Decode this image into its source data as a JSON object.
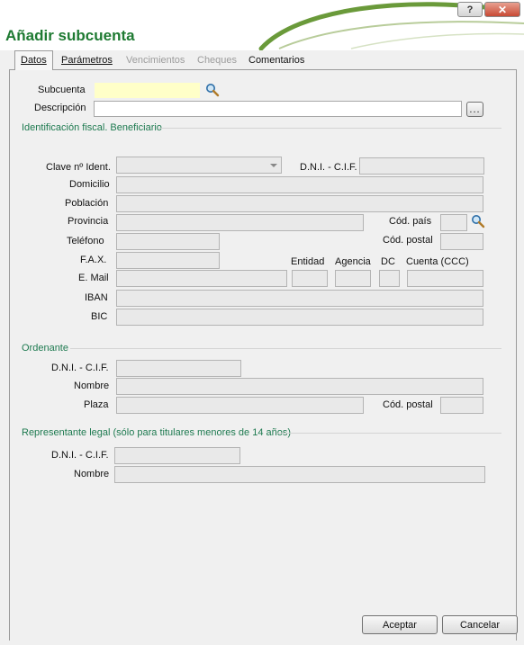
{
  "window": {
    "title": "Añadir subcuenta",
    "help_glyph": "?",
    "close_glyph": "✕",
    "brand_colors": {
      "title": "#1e7a32",
      "section": "#1e7a50",
      "swoosh": "#6a9a3a"
    }
  },
  "tabs": [
    {
      "label": "Datos",
      "state": "active"
    },
    {
      "label": "Parámetros",
      "state": "enabled"
    },
    {
      "label": "Vencimientos",
      "state": "disabled"
    },
    {
      "label": "Cheques",
      "state": "disabled"
    },
    {
      "label": "Comentarios",
      "state": "enabled"
    }
  ],
  "form": {
    "subcuenta": {
      "label": "Subcuenta",
      "value": "",
      "icon": "search-icon"
    },
    "descripcion": {
      "label": "Descripción",
      "value": "",
      "button": "..."
    }
  },
  "beneficiario": {
    "section_title": "Identificación fiscal. Beneficiario",
    "clave_label": "Clave nº Ident.",
    "clave_value": "",
    "dni_label": "D.N.I. - C.I.F.",
    "domicilio_label": "Domicilio",
    "poblacion_label": "Población",
    "provincia_label": "Provincia",
    "cod_pais_label": "Cód. país",
    "telefono_label": "Teléfono",
    "cod_postal_label": "Cód. postal",
    "fax_label": "F.A.X.",
    "email_label": "E. Mail",
    "entidad_label": "Entidad",
    "agencia_label": "Agencia",
    "dc_label": "DC",
    "cuenta_label": "Cuenta (CCC)",
    "iban_label": "IBAN",
    "bic_label": "BIC"
  },
  "ordenante": {
    "section_title": "Ordenante",
    "dni_label": "D.N.I. - C.I.F.",
    "nombre_label": "Nombre",
    "plaza_label": "Plaza",
    "cod_postal_label": "Cód. postal"
  },
  "representante": {
    "section_title": "Representante legal (sólo para titulares menores de 14 años)",
    "dni_label": "D.N.I. - C.I.F.",
    "nombre_label": "Nombre"
  },
  "footer": {
    "accept_label": "Aceptar",
    "cancel_label": "Cancelar"
  }
}
